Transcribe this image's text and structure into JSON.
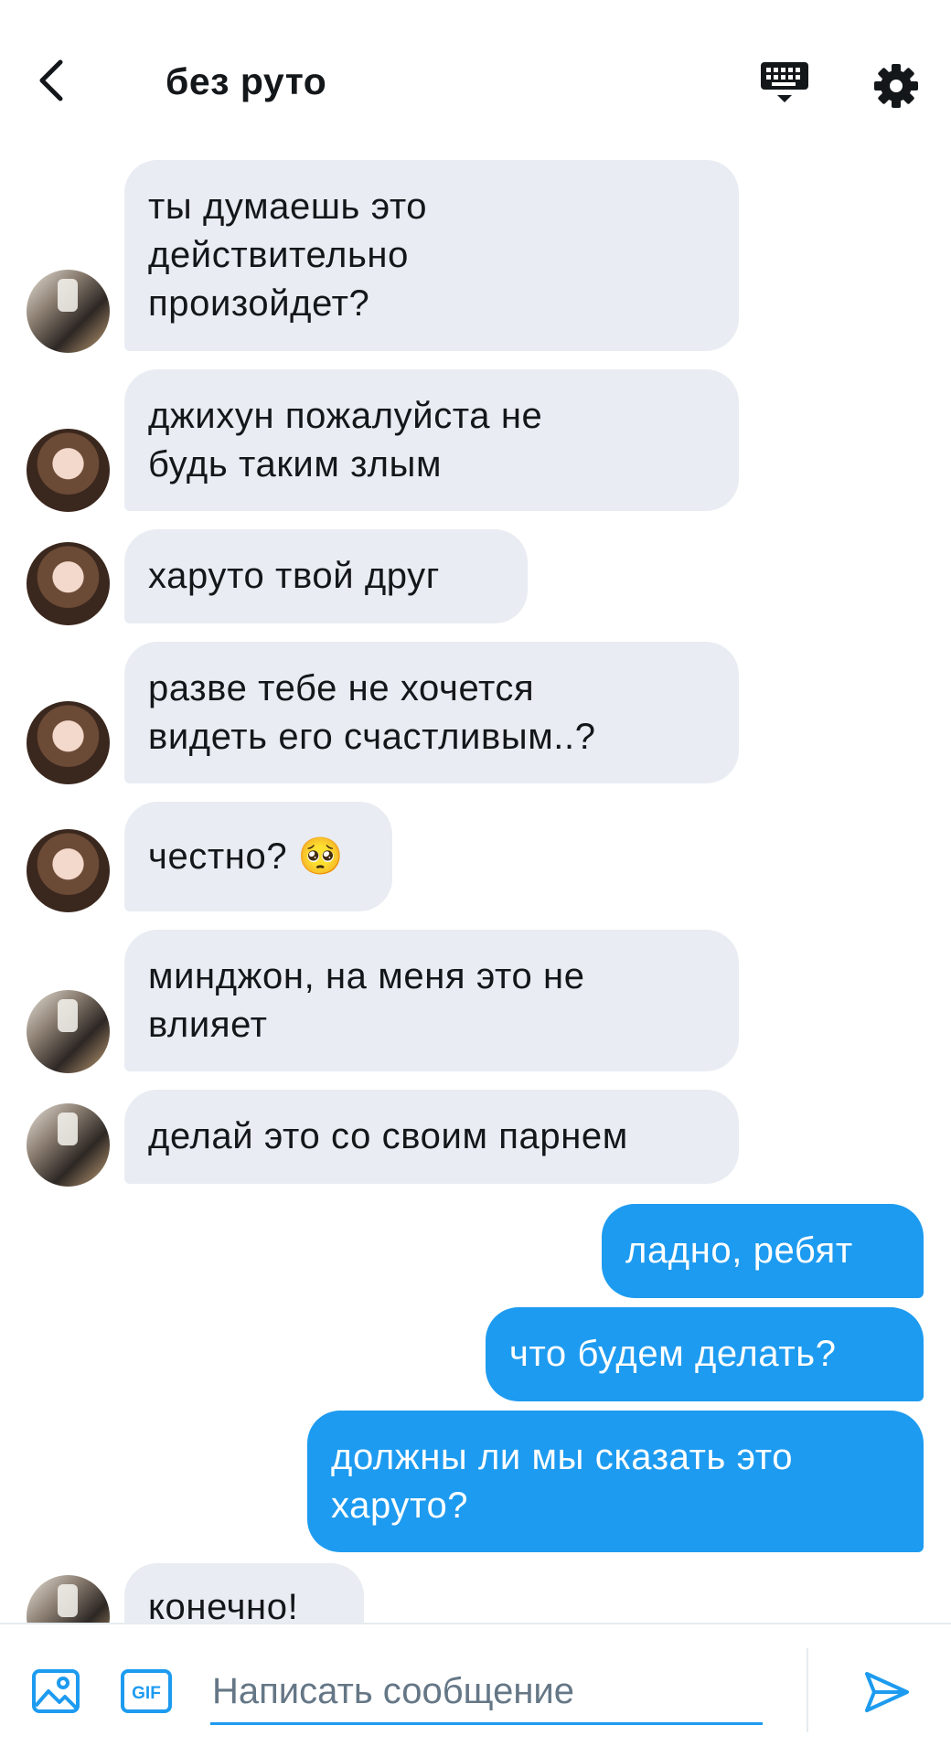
{
  "header": {
    "title": "без руто",
    "back_icon": "chevron-left-icon",
    "keyboard_icon": "keyboard-icon",
    "settings_icon": "gear-icon"
  },
  "messages": [
    {
      "side": "in",
      "avatar": "male",
      "text": "ты думаешь это\nдействительно\nпроизойдет?"
    },
    {
      "side": "in",
      "avatar": "female",
      "text": "джихун пожалуйста не\nбудь таким злым"
    },
    {
      "side": "in",
      "avatar": "female",
      "text": "харуто твой друг"
    },
    {
      "side": "in",
      "avatar": "female",
      "text": "разве тебе не хочется\nвидеть его счастливым..?"
    },
    {
      "side": "in",
      "avatar": "female",
      "text": "честно? 🥺"
    },
    {
      "side": "in",
      "avatar": "male",
      "text": "минджон, на меня это не\nвлияет"
    },
    {
      "side": "in",
      "avatar": "male",
      "text": "делай это со своим парнем"
    },
    {
      "side": "out",
      "text": "ладно, ребят"
    },
    {
      "side": "out",
      "text": "что будем делать?"
    },
    {
      "side": "out",
      "text": "должны ли мы сказать это\nхаруто?"
    },
    {
      "side": "in",
      "avatar": "group",
      "text": "конечно!"
    }
  ],
  "composer": {
    "placeholder": "Написать сообщение",
    "value": "",
    "image_icon": "image-icon",
    "gif_label": "GIF",
    "send_icon": "send-icon"
  },
  "colors": {
    "accent": "#1d9bf0",
    "incoming_bubble": "#e9ecf2",
    "outgoing_text": "#ffffff"
  }
}
